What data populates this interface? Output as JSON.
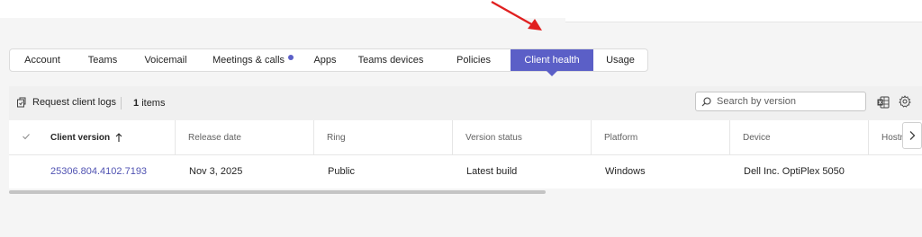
{
  "tabs": [
    {
      "label": "Account"
    },
    {
      "label": "Teams"
    },
    {
      "label": "Voicemail"
    },
    {
      "label": "Meetings & calls"
    },
    {
      "label": "Apps"
    },
    {
      "label": "Teams devices"
    },
    {
      "label": "Policies"
    },
    {
      "label": "Client health"
    },
    {
      "label": "Usage"
    }
  ],
  "active_tab": "Client health",
  "toolbar": {
    "request_logs_label": "Request client logs",
    "count_value": "1",
    "count_label": "items"
  },
  "search": {
    "placeholder": "Search by version"
  },
  "table": {
    "columns": [
      "Client version",
      "Release date",
      "Ring",
      "Version status",
      "Platform",
      "Device",
      "Hostr"
    ],
    "sorted_column": "Client version",
    "rows": [
      [
        "25306.804.4102.7193",
        "Nov 3, 2025",
        "Public",
        "Latest build",
        "Windows",
        "Dell Inc. OptiPlex 5050",
        ""
      ]
    ]
  },
  "colors": {
    "accent": "#5b5fc7",
    "link": "#4f52b2",
    "annotation_arrow": "#e02020"
  },
  "icons": [
    "request-logs-icon",
    "search-icon",
    "excel-icon",
    "gear-icon",
    "check-icon",
    "sort-up-icon",
    "chevron-right-icon",
    "red-arrow-annotation"
  ]
}
